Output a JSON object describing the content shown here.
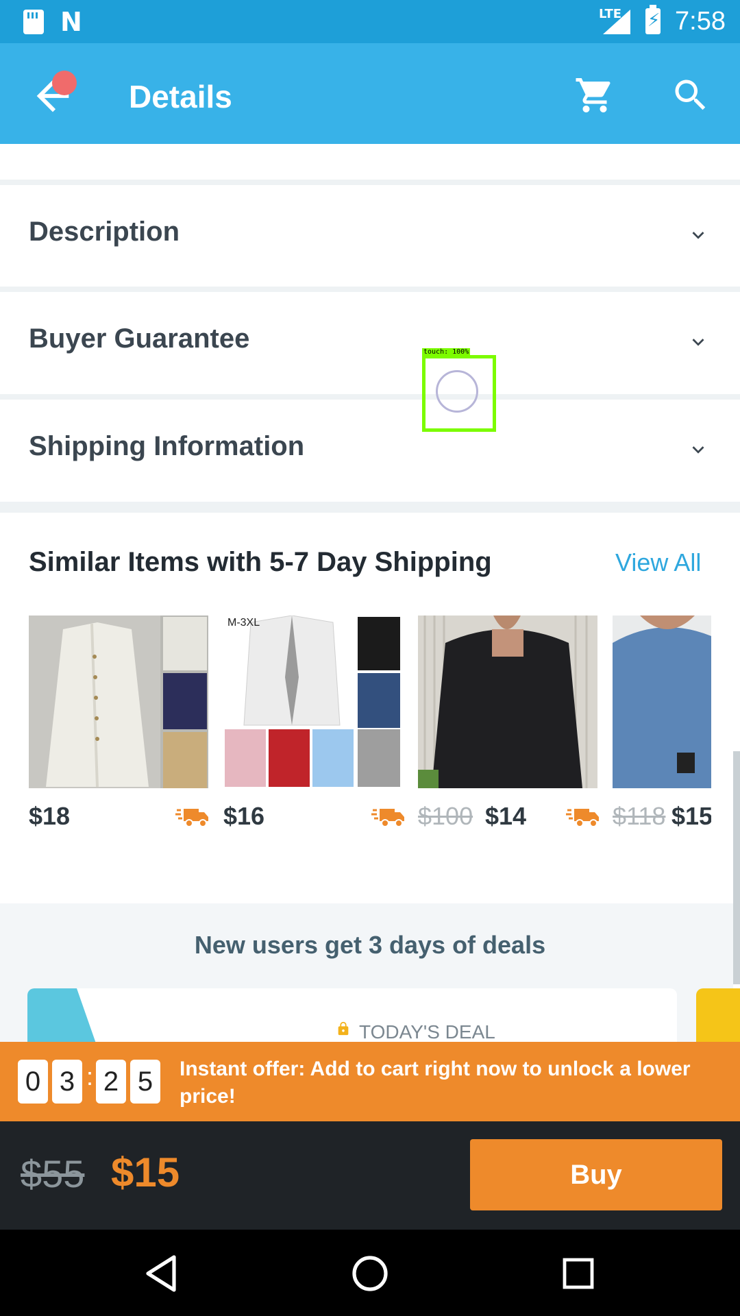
{
  "status_bar": {
    "network": "LTE",
    "time": "7:58"
  },
  "toolbar": {
    "title": "Details"
  },
  "sections": [
    {
      "label": "Description"
    },
    {
      "label": "Buyer Guarantee"
    },
    {
      "label": "Shipping Information"
    }
  ],
  "touch_overlay": {
    "label": "touch: 100%"
  },
  "similar": {
    "title": "Similar Items with 5-7 Day Shipping",
    "view_all": "View All",
    "items": [
      {
        "price": "$18",
        "old_price": "",
        "image_text": ""
      },
      {
        "price": "$16",
        "old_price": "",
        "image_text": "M-3XL"
      },
      {
        "price": "$14",
        "old_price": "$100",
        "image_text": ""
      },
      {
        "price": "$15",
        "old_price": "$118",
        "image_text": ""
      }
    ]
  },
  "deals": {
    "title": "New users get 3 days of deals",
    "card_label": "TODAY'S DEAL"
  },
  "offer": {
    "digits": [
      "0",
      "3",
      "2",
      "5"
    ],
    "separator": ":",
    "text": "Instant offer: Add to cart right now to unlock a lower price!"
  },
  "buy_bar": {
    "old_price": "$55",
    "new_price": "$15",
    "buy_label": "Buy"
  },
  "colors": {
    "status_bar": "#1e9fd8",
    "toolbar": "#38b2e8",
    "accent_orange": "#ee8a2b",
    "link_blue": "#2ea7de",
    "dark_bar": "#1f2327"
  }
}
